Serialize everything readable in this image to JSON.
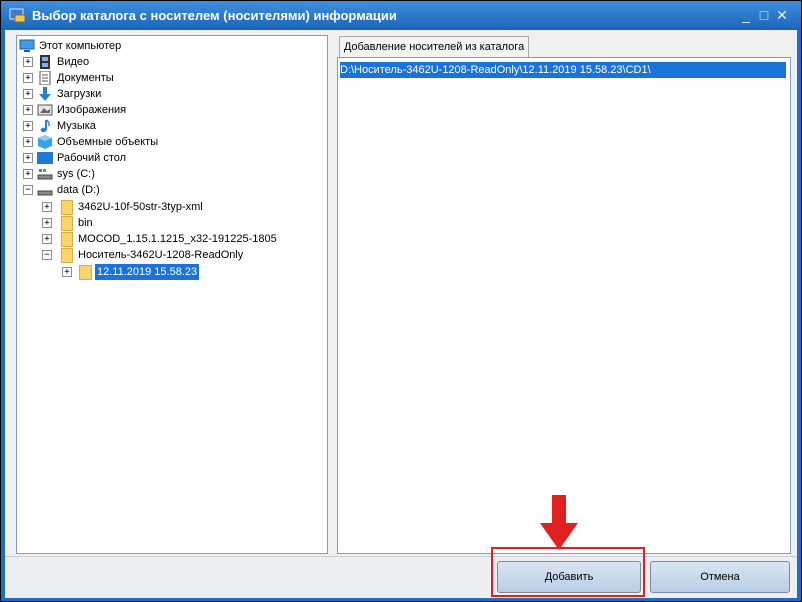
{
  "window": {
    "title": "Выбор каталога с носителем (носителями) информации",
    "controls": [
      "_",
      "□",
      "✕"
    ]
  },
  "tree": {
    "root": "Этот компьютер",
    "items": [
      {
        "label": "Видео",
        "icon": "video-icon"
      },
      {
        "label": "Документы",
        "icon": "documents-icon"
      },
      {
        "label": "Загрузки",
        "icon": "downloads-icon"
      },
      {
        "label": "Изображения",
        "icon": "images-icon"
      },
      {
        "label": "Музыка",
        "icon": "music-icon"
      },
      {
        "label": "Объемные объекты",
        "icon": "3d-objects-icon"
      },
      {
        "label": "Рабочий стол",
        "icon": "desktop-icon"
      },
      {
        "label": "sys (C:)",
        "icon": "drive-icon"
      },
      {
        "label": "data (D:)",
        "icon": "drive-icon"
      }
    ],
    "data_children": [
      {
        "label": "3462U-10f-50str-3typ-xml"
      },
      {
        "label": "bin"
      },
      {
        "label": "MOCOD_1.15.1.1215_x32-191225-1805"
      },
      {
        "label": "Носитель-3462U-1208-ReadOnly"
      }
    ],
    "selected": "12.11.2019 15.58.23"
  },
  "panel": {
    "tab_label": "Добавление носителей из каталога",
    "selected_path": "D:\\Носитель-3462U-1208-ReadOnly\\12.11.2019 15.58.23\\CD1\\"
  },
  "buttons": {
    "add": "Добавить",
    "cancel": "Отмена"
  },
  "colors": {
    "selection": "#1a73d9",
    "annotation": "#e02020"
  }
}
